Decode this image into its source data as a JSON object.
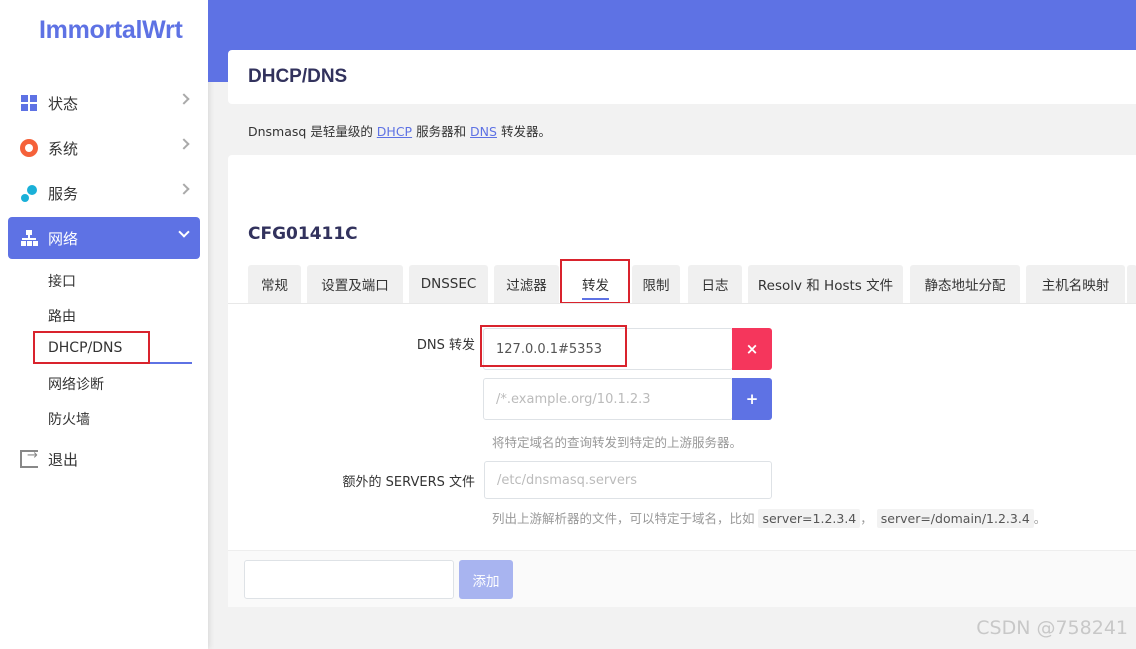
{
  "brand": {
    "logo_text": "ImmortalWrt",
    "accent_color": "#5e72e4"
  },
  "sidebar": {
    "items": [
      {
        "label": "状态",
        "icon": "dashboard-icon"
      },
      {
        "label": "系统",
        "icon": "gear-icon"
      },
      {
        "label": "服务",
        "icon": "cogs-icon"
      },
      {
        "label": "网络",
        "icon": "network-icon",
        "active": true
      },
      {
        "label": "退出",
        "icon": "logout-icon"
      }
    ],
    "network_subitems": [
      "接口",
      "路由",
      "DHCP/DNS",
      "网络诊断",
      "防火墙"
    ]
  },
  "page": {
    "title": "DHCP/DNS",
    "description_prefix": "Dnsmasq 是轻量级的 ",
    "description_link1": "DHCP",
    "description_middle": " 服务器和 ",
    "description_link2": "DNS",
    "description_suffix": " 转发器。",
    "section_title": "CFG01411C"
  },
  "tabs": [
    "常规",
    "设置及端口",
    "DNSSEC",
    "过滤器",
    "转发",
    "限制",
    "日志",
    "Resolv 和 Hosts 文件",
    "静态地址分配",
    "主机名映射"
  ],
  "active_tab": "转发",
  "form": {
    "dns_forward": {
      "label": "DNS 转发",
      "value": "127.0.0.1#5353",
      "placeholder": "/*.example.org/10.1.2.3",
      "delete_button": "×",
      "add_button": "+",
      "help": "将特定域名的查询转发到特定的上游服务器。"
    },
    "servers_file": {
      "label": "额外的 SERVERS 文件",
      "placeholder": "/etc/dnsmasq.servers",
      "help_prefix": "列出上游解析器的文件，可以特定于域名，比如 ",
      "help_code1": "server=1.2.3.4",
      "help_sep": "，",
      "help_code2": "server=/domain/1.2.3.4",
      "help_suffix": "。"
    }
  },
  "footer": {
    "add_button": "添加"
  },
  "watermark": "CSDN @758241"
}
